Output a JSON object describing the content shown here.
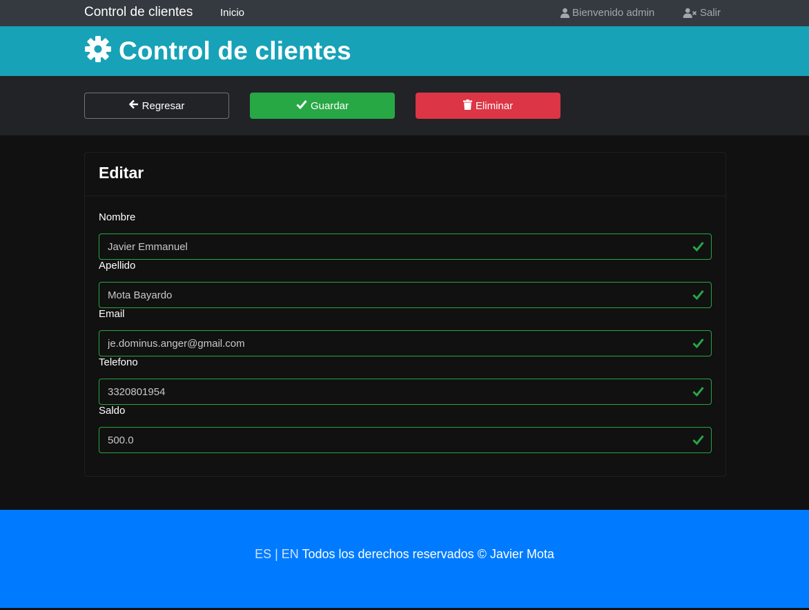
{
  "nav": {
    "brand": "Control de clientes",
    "home": "Inicio",
    "welcome": "Bienvenido admin",
    "logout": "Salir",
    "welcome_icon": "user-icon",
    "logout_icon": "user-times-icon"
  },
  "header": {
    "title": "Control de clientes",
    "icon": "gear-icon"
  },
  "actions": {
    "back_label": "Regresar",
    "save_label": "Guardar",
    "delete_label": "Eliminar"
  },
  "card": {
    "title": "Editar",
    "fields": [
      {
        "label": "Nombre",
        "value": "Javier Emmanuel"
      },
      {
        "label": "Apellido",
        "value": "Mota Bayardo"
      },
      {
        "label": "Email",
        "value": "je.dominus.anger@gmail.com"
      },
      {
        "label": "Telefono",
        "value": "3320801954"
      },
      {
        "label": "Saldo",
        "value": "500.0"
      }
    ]
  },
  "footer": {
    "lang_es": "ES",
    "lang_sep": "|",
    "lang_en": "EN",
    "text": "Todos los derechos reservados © Javier Mota"
  },
  "colors": {
    "navbar": "#343a40",
    "header": "#17a2b8",
    "success": "#28a745",
    "danger": "#dc3545",
    "footer": "#007bff"
  }
}
